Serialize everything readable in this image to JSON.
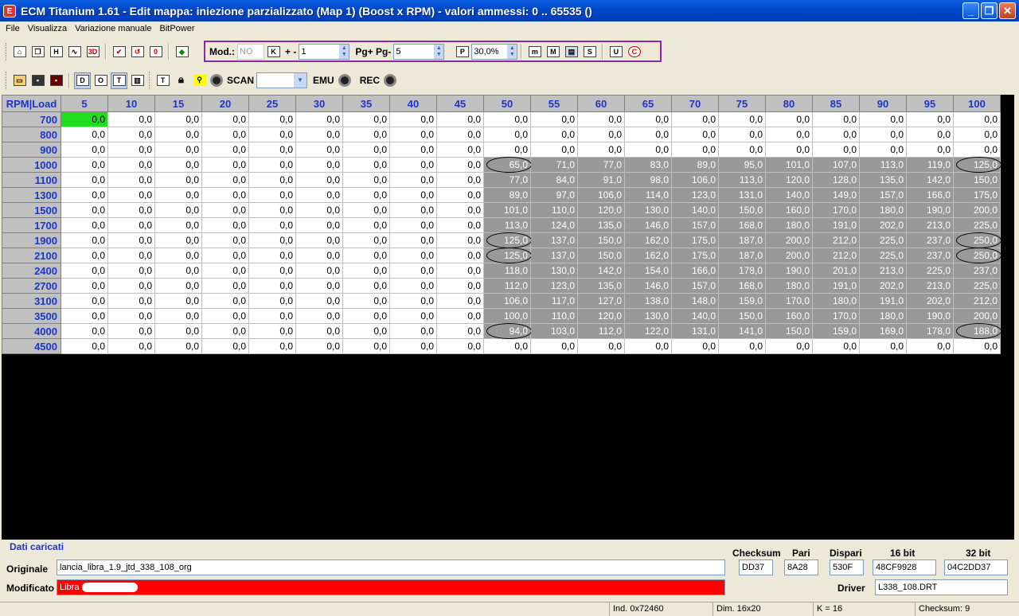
{
  "window": {
    "title": "ECM Titanium 1.61 - Edit mappa: iniezione parzializzato (Map 1) (Boost x RPM) - valori ammessi: 0 .. 65535 ()",
    "minimize": "_",
    "maximize": "❐",
    "close": "✕"
  },
  "menu": [
    "File",
    "Visualizza",
    "Variazione manuale",
    "BitPower"
  ],
  "toolbar1": {
    "mod_label": "Mod.:",
    "mod_value": "NO",
    "k_button": "K",
    "plusminus_label": "+ -",
    "step_value": "1",
    "pg_label": "Pg+ Pg-",
    "pg_value": "5",
    "p_button": "P",
    "percent_value": "30,0%",
    "icons": [
      "m",
      "M",
      "graph",
      "S",
      "U",
      "C"
    ]
  },
  "toolbar2": {
    "scan_label": "SCAN",
    "scan_value": "",
    "emu_label": "EMU",
    "rec_label": "REC"
  },
  "map": {
    "corner_label": "RPM|Load",
    "load_headers": [
      "5",
      "10",
      "15",
      "20",
      "25",
      "30",
      "35",
      "40",
      "45",
      "50",
      "55",
      "60",
      "65",
      "70",
      "75",
      "80",
      "85",
      "90",
      "95",
      "100"
    ],
    "rows": [
      {
        "rpm": "700",
        "values": [
          "0,0",
          "0,0",
          "0,0",
          "0,0",
          "0,0",
          "0,0",
          "0,0",
          "0,0",
          "0,0",
          "0,0",
          "0,0",
          "0,0",
          "0,0",
          "0,0",
          "0,0",
          "0,0",
          "0,0",
          "0,0",
          "0,0",
          "0,0"
        ]
      },
      {
        "rpm": "800",
        "values": [
          "0,0",
          "0,0",
          "0,0",
          "0,0",
          "0,0",
          "0,0",
          "0,0",
          "0,0",
          "0,0",
          "0,0",
          "0,0",
          "0,0",
          "0,0",
          "0,0",
          "0,0",
          "0,0",
          "0,0",
          "0,0",
          "0,0",
          "0,0"
        ]
      },
      {
        "rpm": "900",
        "values": [
          "0,0",
          "0,0",
          "0,0",
          "0,0",
          "0,0",
          "0,0",
          "0,0",
          "0,0",
          "0,0",
          "0,0",
          "0,0",
          "0,0",
          "0,0",
          "0,0",
          "0,0",
          "0,0",
          "0,0",
          "0,0",
          "0,0",
          "0,0"
        ]
      },
      {
        "rpm": "1000",
        "values": [
          "0,0",
          "0,0",
          "0,0",
          "0,0",
          "0,0",
          "0,0",
          "0,0",
          "0,0",
          "0,0",
          "65,0",
          "71,0",
          "77,0",
          "83,0",
          "89,0",
          "95,0",
          "101,0",
          "107,0",
          "113,0",
          "119,0",
          "125,0"
        ]
      },
      {
        "rpm": "1100",
        "values": [
          "0,0",
          "0,0",
          "0,0",
          "0,0",
          "0,0",
          "0,0",
          "0,0",
          "0,0",
          "0,0",
          "77,0",
          "84,0",
          "91,0",
          "98,0",
          "106,0",
          "113,0",
          "120,0",
          "128,0",
          "135,0",
          "142,0",
          "150,0"
        ]
      },
      {
        "rpm": "1300",
        "values": [
          "0,0",
          "0,0",
          "0,0",
          "0,0",
          "0,0",
          "0,0",
          "0,0",
          "0,0",
          "0,0",
          "89,0",
          "97,0",
          "106,0",
          "114,0",
          "123,0",
          "131,0",
          "140,0",
          "149,0",
          "157,0",
          "166,0",
          "175,0"
        ]
      },
      {
        "rpm": "1500",
        "values": [
          "0,0",
          "0,0",
          "0,0",
          "0,0",
          "0,0",
          "0,0",
          "0,0",
          "0,0",
          "0,0",
          "101,0",
          "110,0",
          "120,0",
          "130,0",
          "140,0",
          "150,0",
          "160,0",
          "170,0",
          "180,0",
          "190,0",
          "200,0"
        ]
      },
      {
        "rpm": "1700",
        "values": [
          "0,0",
          "0,0",
          "0,0",
          "0,0",
          "0,0",
          "0,0",
          "0,0",
          "0,0",
          "0,0",
          "113,0",
          "124,0",
          "135,0",
          "146,0",
          "157,0",
          "168,0",
          "180,0",
          "191,0",
          "202,0",
          "213,0",
          "225,0"
        ]
      },
      {
        "rpm": "1900",
        "values": [
          "0,0",
          "0,0",
          "0,0",
          "0,0",
          "0,0",
          "0,0",
          "0,0",
          "0,0",
          "0,0",
          "125,0",
          "137,0",
          "150,0",
          "162,0",
          "175,0",
          "187,0",
          "200,0",
          "212,0",
          "225,0",
          "237,0",
          "250,0"
        ]
      },
      {
        "rpm": "2100",
        "values": [
          "0,0",
          "0,0",
          "0,0",
          "0,0",
          "0,0",
          "0,0",
          "0,0",
          "0,0",
          "0,0",
          "125,0",
          "137,0",
          "150,0",
          "162,0",
          "175,0",
          "187,0",
          "200,0",
          "212,0",
          "225,0",
          "237,0",
          "250,0"
        ]
      },
      {
        "rpm": "2400",
        "values": [
          "0,0",
          "0,0",
          "0,0",
          "0,0",
          "0,0",
          "0,0",
          "0,0",
          "0,0",
          "0,0",
          "118,0",
          "130,0",
          "142,0",
          "154,0",
          "166,0",
          "178,0",
          "190,0",
          "201,0",
          "213,0",
          "225,0",
          "237,0"
        ]
      },
      {
        "rpm": "2700",
        "values": [
          "0,0",
          "0,0",
          "0,0",
          "0,0",
          "0,0",
          "0,0",
          "0,0",
          "0,0",
          "0,0",
          "112,0",
          "123,0",
          "135,0",
          "146,0",
          "157,0",
          "168,0",
          "180,0",
          "191,0",
          "202,0",
          "213,0",
          "225,0"
        ]
      },
      {
        "rpm": "3100",
        "values": [
          "0,0",
          "0,0",
          "0,0",
          "0,0",
          "0,0",
          "0,0",
          "0,0",
          "0,0",
          "0,0",
          "106,0",
          "117,0",
          "127,0",
          "138,0",
          "148,0",
          "159,0",
          "170,0",
          "180,0",
          "191,0",
          "202,0",
          "212,0"
        ]
      },
      {
        "rpm": "3500",
        "values": [
          "0,0",
          "0,0",
          "0,0",
          "0,0",
          "0,0",
          "0,0",
          "0,0",
          "0,0",
          "0,0",
          "100,0",
          "110,0",
          "120,0",
          "130,0",
          "140,0",
          "150,0",
          "160,0",
          "170,0",
          "180,0",
          "190,0",
          "200,0"
        ]
      },
      {
        "rpm": "4000",
        "values": [
          "0,0",
          "0,0",
          "0,0",
          "0,0",
          "0,0",
          "0,0",
          "0,0",
          "0,0",
          "0,0",
          "94,0",
          "103,0",
          "112,0",
          "122,0",
          "131,0",
          "141,0",
          "150,0",
          "159,0",
          "169,0",
          "178,0",
          "188,0"
        ]
      },
      {
        "rpm": "4500",
        "values": [
          "0,0",
          "0,0",
          "0,0",
          "0,0",
          "0,0",
          "0,0",
          "0,0",
          "0,0",
          "0,0",
          "0,0",
          "0,0",
          "0,0",
          "0,0",
          "0,0",
          "0,0",
          "0,0",
          "0,0",
          "0,0",
          "0,0",
          "0,0"
        ]
      }
    ],
    "modified_rows": [
      "1000",
      "1100",
      "1300",
      "1500",
      "1700",
      "1900",
      "2100",
      "2400",
      "2700",
      "3100",
      "3500",
      "4000"
    ],
    "modified_from_col": 9,
    "circled": [
      [
        "1000",
        9
      ],
      [
        "1000",
        19
      ],
      [
        "1900",
        9
      ],
      [
        "1900",
        19
      ],
      [
        "2100",
        9
      ],
      [
        "2100",
        19
      ],
      [
        "4000",
        9
      ],
      [
        "4000",
        19
      ]
    ],
    "selected_cell": [
      "700",
      0
    ],
    "colors": {
      "header_text": "#1a36c8",
      "modified_bg": "#999999",
      "selected_bg": "#22dd22"
    }
  },
  "loaded": {
    "title": "Dati caricati",
    "originale_label": "Originale",
    "originale_value": "lancia_libra_1.9_jtd_338_108_org",
    "modificato_label": "Modificato",
    "modificato_value": "Libra",
    "checksum_label": "Checksum",
    "pari_label": "Pari",
    "dispari_label": "Dispari",
    "bit16_label": "16 bit",
    "bit32_label": "32 bit",
    "checksum_value": "DD37",
    "pari_value": "8A28",
    "dispari_value": "530F",
    "bit16_value": "48CF9928",
    "bit32_value": "04C2DD37",
    "driver_label": "Driver",
    "driver_value": "L338_108.DRT"
  },
  "status": {
    "ind": "Ind. 0x72460",
    "dim": "Dim. 16x20",
    "k": "K = 16",
    "checksum": "Checksum: 9"
  }
}
